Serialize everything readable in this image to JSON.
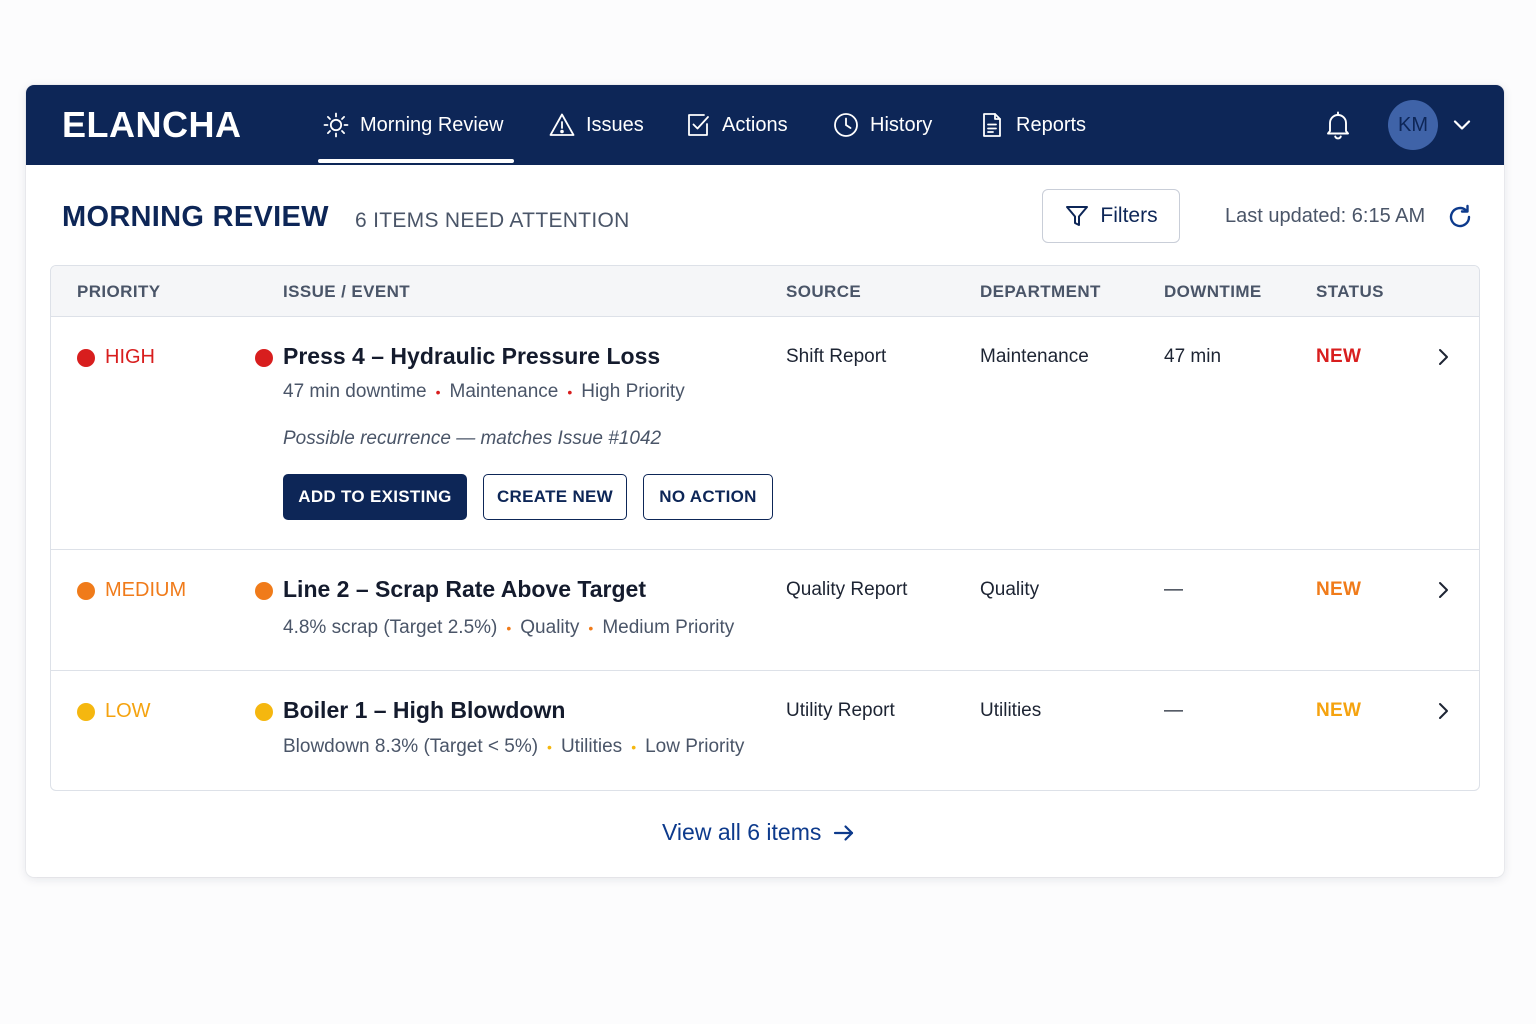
{
  "app": {
    "logo": "ELANCHA"
  },
  "nav": {
    "items": [
      {
        "label": "Morning Review",
        "icon": "sun-icon",
        "active": true
      },
      {
        "label": "Issues",
        "icon": "warning-triangle-icon"
      },
      {
        "label": "Actions",
        "icon": "checkbox-icon"
      },
      {
        "label": "History",
        "icon": "clock-icon"
      },
      {
        "label": "Reports",
        "icon": "document-icon"
      }
    ],
    "avatar_initials": "KM"
  },
  "header": {
    "title": "MORNING REVIEW",
    "attention": "6 ITEMS NEED ATTENTION",
    "filters_label": "Filters",
    "last_updated": "Last updated: 6:15 AM"
  },
  "table": {
    "columns": [
      "PRIORITY",
      "ISSUE / EVENT",
      "SOURCE",
      "DEPARTMENT",
      "DOWNTIME",
      "STATUS"
    ],
    "rows": [
      {
        "priority": "HIGH",
        "title": "Press 4 – Hydraulic Pressure Loss",
        "meta": [
          "47 min downtime",
          "Maintenance",
          "High Priority"
        ],
        "note": "Possible recurrence — matches Issue #1042",
        "actions": [
          "ADD TO EXISTING",
          "CREATE NEW",
          "NO ACTION"
        ],
        "source": "Shift Report",
        "department": "Maintenance",
        "downtime": "47 min",
        "status": "NEW"
      },
      {
        "priority": "MEDIUM",
        "title": "Line 2 – Scrap Rate Above Target",
        "meta": [
          "4.8% scrap (Target 2.5%)",
          "Quality",
          "Medium Priority"
        ],
        "source": "Quality Report",
        "department": "Quality",
        "downtime": "—",
        "status": "NEW"
      },
      {
        "priority": "LOW",
        "title": "Boiler 1 – High Blowdown",
        "meta": [
          "Blowdown 8.3% (Target < 5%)",
          "Utilities",
          "Low Priority"
        ],
        "source": "Utility Report",
        "department": "Utilities",
        "downtime": "—",
        "status": "NEW"
      }
    ],
    "meta_separator": "•"
  },
  "footer": {
    "view_all": "View all 6 items"
  },
  "colors": {
    "navy": "#0d2657",
    "high": "#d81e1e",
    "medium": "#f07b1a",
    "low": "#f5b70f",
    "status_new_high": "#d81e1e",
    "status_new_medium": "#f07b1a",
    "status_new_low": "#f5a30f"
  }
}
